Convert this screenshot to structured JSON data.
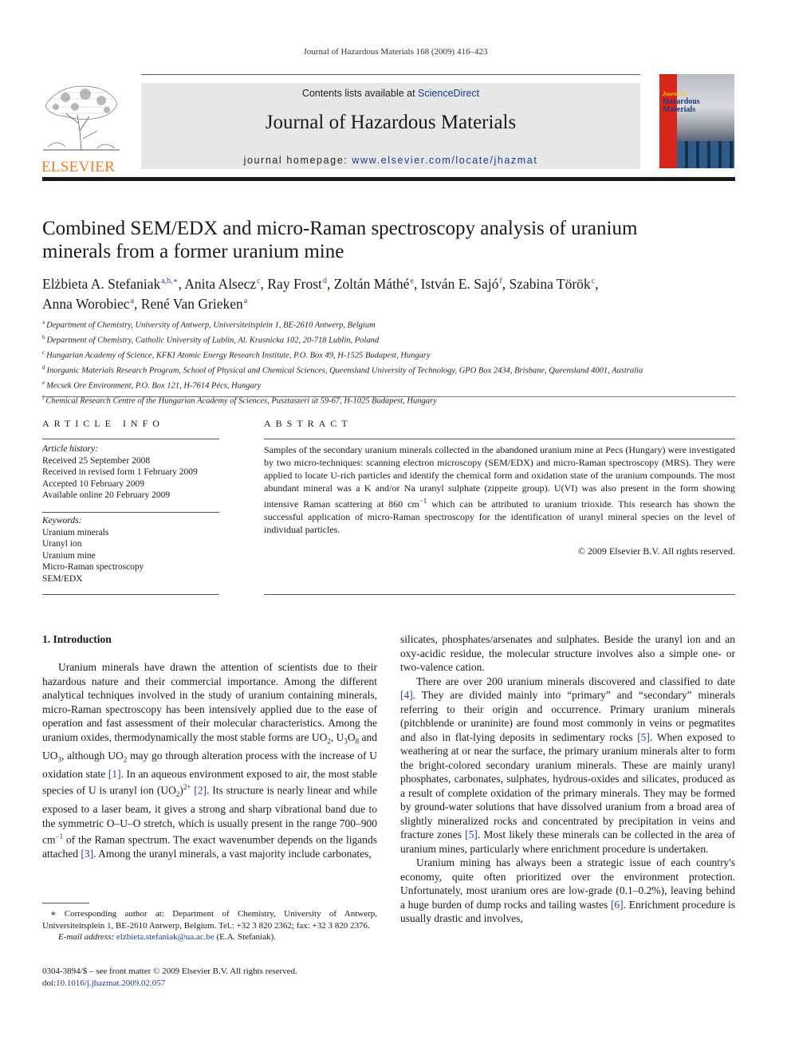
{
  "running_head": "Journal of Hazardous Materials 168 (2009) 416–423",
  "masthead": {
    "publisher_logo": "ELSEVIER",
    "contents_prefix": "Contents lists available at ",
    "contents_link": "ScienceDirect",
    "journal_name": "Journal of Hazardous Materials",
    "homepage_prefix": "journal homepage: ",
    "homepage_url": "www.elsevier.com/locate/jhazmat",
    "cover": {
      "small": "Journal of",
      "title1": "Hazardous",
      "title2": "Materials"
    }
  },
  "colors": {
    "link": "#1f3a8a",
    "elsevier_orange": "#f47b20",
    "masthead_bg": "#e6e7e8",
    "cover_red": "#d8261f"
  },
  "title_line1": "Combined SEM/EDX and micro-Raman spectroscopy analysis of uranium",
  "title_line2": "minerals from a former uranium mine",
  "authors": [
    {
      "name": "Elżbieta A. Stefaniak",
      "aff": "a,b,∗",
      "sep": ", "
    },
    {
      "name": "Anita Alsecz",
      "aff": "c",
      "sep": ", "
    },
    {
      "name": "Ray Frost",
      "aff": "d",
      "sep": ", "
    },
    {
      "name": "Zoltán Máthé",
      "aff": "e",
      "sep": ", "
    },
    {
      "name": "István E. Sajó",
      "aff": "f",
      "sep": ", "
    },
    {
      "name": "Szabina Török",
      "aff": "c",
      "sep": ","
    },
    {
      "name": "Anna Worobiec",
      "aff": "a",
      "sep": ", "
    },
    {
      "name": "René Van Grieken",
      "aff": "a",
      "sep": ""
    }
  ],
  "affiliations": [
    {
      "key": "a",
      "text": "Department of Chemistry, University of Antwerp, Universiteitsplein 1, BE-2610 Antwerp, Belgium"
    },
    {
      "key": "b",
      "text": "Department of Chemistry, Catholic University of Lublin, Al. Krasnicka 102, 20-718 Lublin, Poland"
    },
    {
      "key": "c",
      "text": "Hungarian Academy of Science, KFKI Atomic Energy Research Institute, P.O. Box 49, H-1525 Budapest, Hungary"
    },
    {
      "key": "d",
      "text": "Inorganic Materials Research Program, School of Physical and Chemical Sciences, Queensland University of Technology, GPO Box 2434, Brisbane, Queensland 4001, Australia"
    },
    {
      "key": "e",
      "text": "Mecsek Ore Environment, P.O. Box 121, H-7614 Pécs, Hungary"
    },
    {
      "key": "f",
      "text": "Chemical Research Centre of the Hungarian Academy of Sciences, Pusztaszeri út 59-67, H-1025 Budapest, Hungary"
    }
  ],
  "article_info": {
    "heading": "ARTICLE INFO",
    "history_label": "Article history:",
    "history": [
      "Received 25 September 2008",
      "Received in revised form 1 February 2009",
      "Accepted 10 February 2009",
      "Available online 20 February 2009"
    ],
    "keywords_label": "Keywords:",
    "keywords": [
      "Uranium minerals",
      "Uranyl ion",
      "Uranium mine",
      "Micro-Raman spectroscopy",
      "SEM/EDX"
    ]
  },
  "abstract": {
    "heading": "ABSTRACT",
    "text_before_unit": "Samples of the secondary uranium minerals collected in the abandoned uranium mine at Pecs (Hungary) were investigated by two micro-techniques: scanning electron microscopy (SEM/EDX) and micro-Raman spectroscopy (MRS). They were applied to locate U-rich particles and identify the chemical form and oxidation state of the uranium compounds. The most abundant mineral was a K and/or Na uranyl sulphate (zippeite group). U(VI) was also present in the form showing intensive Raman scattering at 860 cm",
    "unit_exp": "−1",
    "text_after_unit": " which can be attributed to uranium trioxide. This research has shown the successful application of micro-Raman spectroscopy for the identification of uranyl mineral species on the level of individual particles.",
    "copyright": "© 2009 Elsevier B.V. All rights reserved."
  },
  "introduction": {
    "heading": "1.  Introduction",
    "left_p1_a": "Uranium minerals have drawn the attention of scientists due to their hazardous nature and their commercial importance. Among the different analytical techniques involved in the study of uranium containing minerals, micro-Raman spectroscopy has been intensively applied due to the ease of operation and fast assessment of their molecular characteristics. Among the uranium oxides, thermodynamically the most stable forms are UO",
    "left_p1_b": ", U",
    "left_p1_c": "O",
    "left_p1_d": " and UO",
    "left_p1_e": ", although UO",
    "left_p1_f": " may go through alteration process with the increase of U oxidation state ",
    "ref1": "[1]",
    "left_p1_g": ". In an aqueous environment exposed to air, the most stable species of U is uranyl ion (UO",
    "left_p1_h": ")",
    "charge": "2+",
    "ref2": "[2]",
    "left_p1_i": ". Its structure is nearly linear and while exposed to a laser beam, it gives a strong and sharp vibrational band due to the symmetric O–U–O stretch, which is usually present in the range 700–900 cm",
    "exp": "−1",
    "left_p1_j": " of the Raman spectrum. The exact wavenumber depends on the ligands attached ",
    "ref3": "[3]",
    "left_p1_k": ". Among the uranyl minerals, a vast majority include carbonates,",
    "sub2": "2",
    "sub3": "3",
    "sub8": "8",
    "right_p1": "silicates, phosphates/arsenates and sulphates. Beside the uranyl ion and an oxy-acidic residue, the molecular structure involves also a simple one- or two-valence cation.",
    "right_p2_a": "There are over 200 uranium minerals discovered and classified to date ",
    "ref4": "[4]",
    "right_p2_b": ". They are divided mainly into “primary” and “secondary” minerals referring to their origin and occurrence. Primary uranium minerals (pitchblende or uraninite) are found most commonly in veins or pegmatites and also in flat-lying deposits in sedimentary rocks ",
    "ref5": "[5]",
    "right_p2_c": ". When exposed to weathering at or near the surface, the primary uranium minerals alter to form the bright-colored secondary uranium minerals. These are mainly uranyl phosphates, carbonates, sulphates, hydrous-oxides and silicates, produced as a result of complete oxidation of the primary minerals. They may be formed by ground-water solutions that have dissolved uranium from a broad area of slightly mineralized rocks and concentrated by precipitation in veins and fracture zones ",
    "ref5b": "[5]",
    "right_p2_d": ". Most likely these minerals can be collected in the area of uranium mines, particularly where enrichment procedure is undertaken.",
    "right_p3_a": "Uranium mining has always been a strategic issue of each country's economy, quite often prioritized over the environment protection. Unfortunately, most uranium ores are low-grade (0.1–0.2%), leaving behind a huge burden of dump rocks and tailing wastes ",
    "ref6": "[6]",
    "right_p3_b": ". Enrichment procedure is usually drastic and involves,"
  },
  "footnote": {
    "star": "∗",
    "text": " Corresponding author at: Department of Chemistry, University of Antwerp, Universiteitsplein 1, BE-2610 Antwerp, Belgium. Tel.: +32 3 820 2362; fax: +32 3 820 2376.",
    "email_label": "E-mail address: ",
    "email": "elzbieta.stefaniak@ua.ac.be",
    "email_suffix": " (E.A. Stefaniak)."
  },
  "front_matter": {
    "line1": "0304-3894/$ – see front matter © 2009 Elsevier B.V. All rights reserved.",
    "doi_prefix": "doi:",
    "doi": "10.1016/j.jhazmat.2009.02.057"
  }
}
